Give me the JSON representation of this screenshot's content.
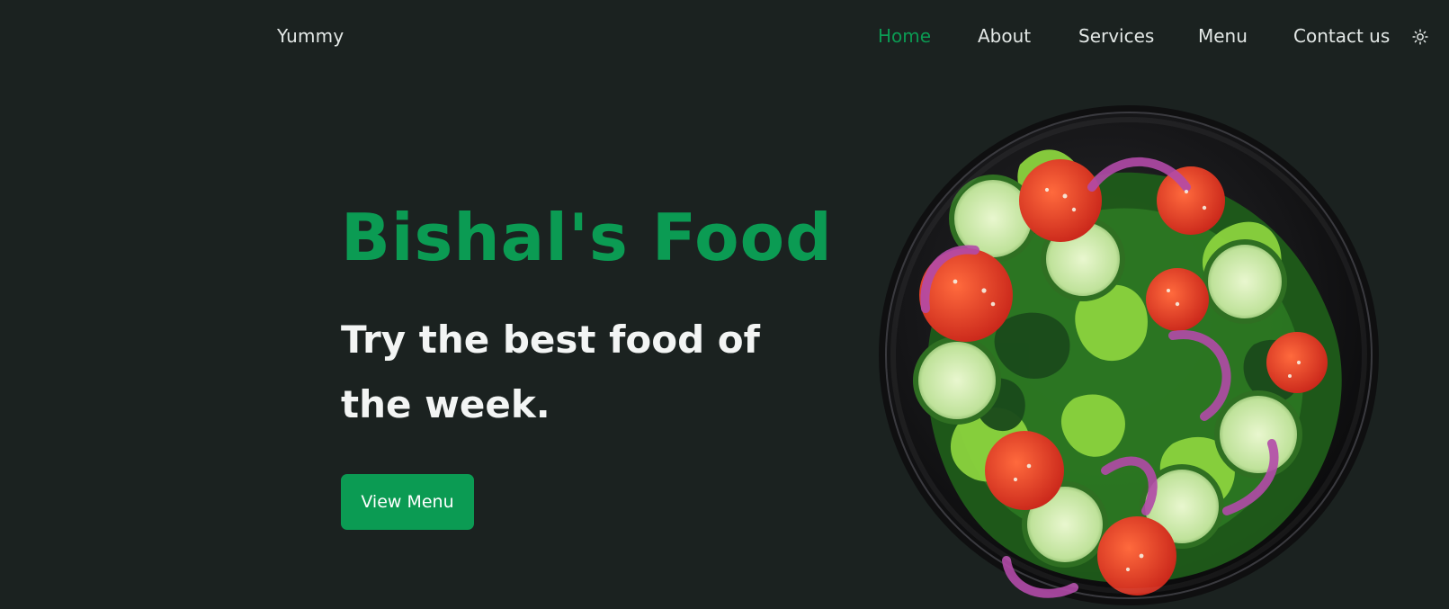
{
  "brand": {
    "name": "Yummy"
  },
  "nav": {
    "items": [
      {
        "label": "Home",
        "active": true
      },
      {
        "label": "About",
        "active": false
      },
      {
        "label": "Services",
        "active": false
      },
      {
        "label": "Menu",
        "active": false
      },
      {
        "label": "Contact us",
        "active": false
      }
    ],
    "theme_toggle_icon": "sun-icon"
  },
  "hero": {
    "title": "Bishal's Food",
    "subtitle": "Try the best food of the week.",
    "cta_label": "View Menu",
    "image": "salad-bowl"
  },
  "colors": {
    "background": "#1b2220",
    "accent": "#0b9b53",
    "text": "#e9eeec"
  }
}
